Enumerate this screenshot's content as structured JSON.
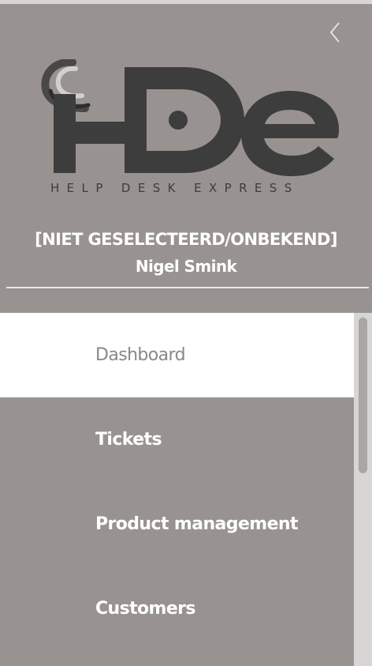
{
  "header": {
    "logo_text": "HDe",
    "tagline": "HELP DESK EXPRESS",
    "company": "[NIET GESELECTEERD/ONBEKEND]",
    "user_name": "Nigel Smink",
    "back_icon": "chevron-left-icon"
  },
  "menu": {
    "items": [
      {
        "label": "Dashboard",
        "active": true
      },
      {
        "label": "Tickets",
        "active": false
      },
      {
        "label": "Product management",
        "active": false
      },
      {
        "label": "Customers",
        "active": false
      }
    ]
  },
  "colors": {
    "panel_bg": "#989390",
    "active_bg": "#ffffff",
    "logo": "#3e3d3d",
    "text": "#ffffff"
  }
}
